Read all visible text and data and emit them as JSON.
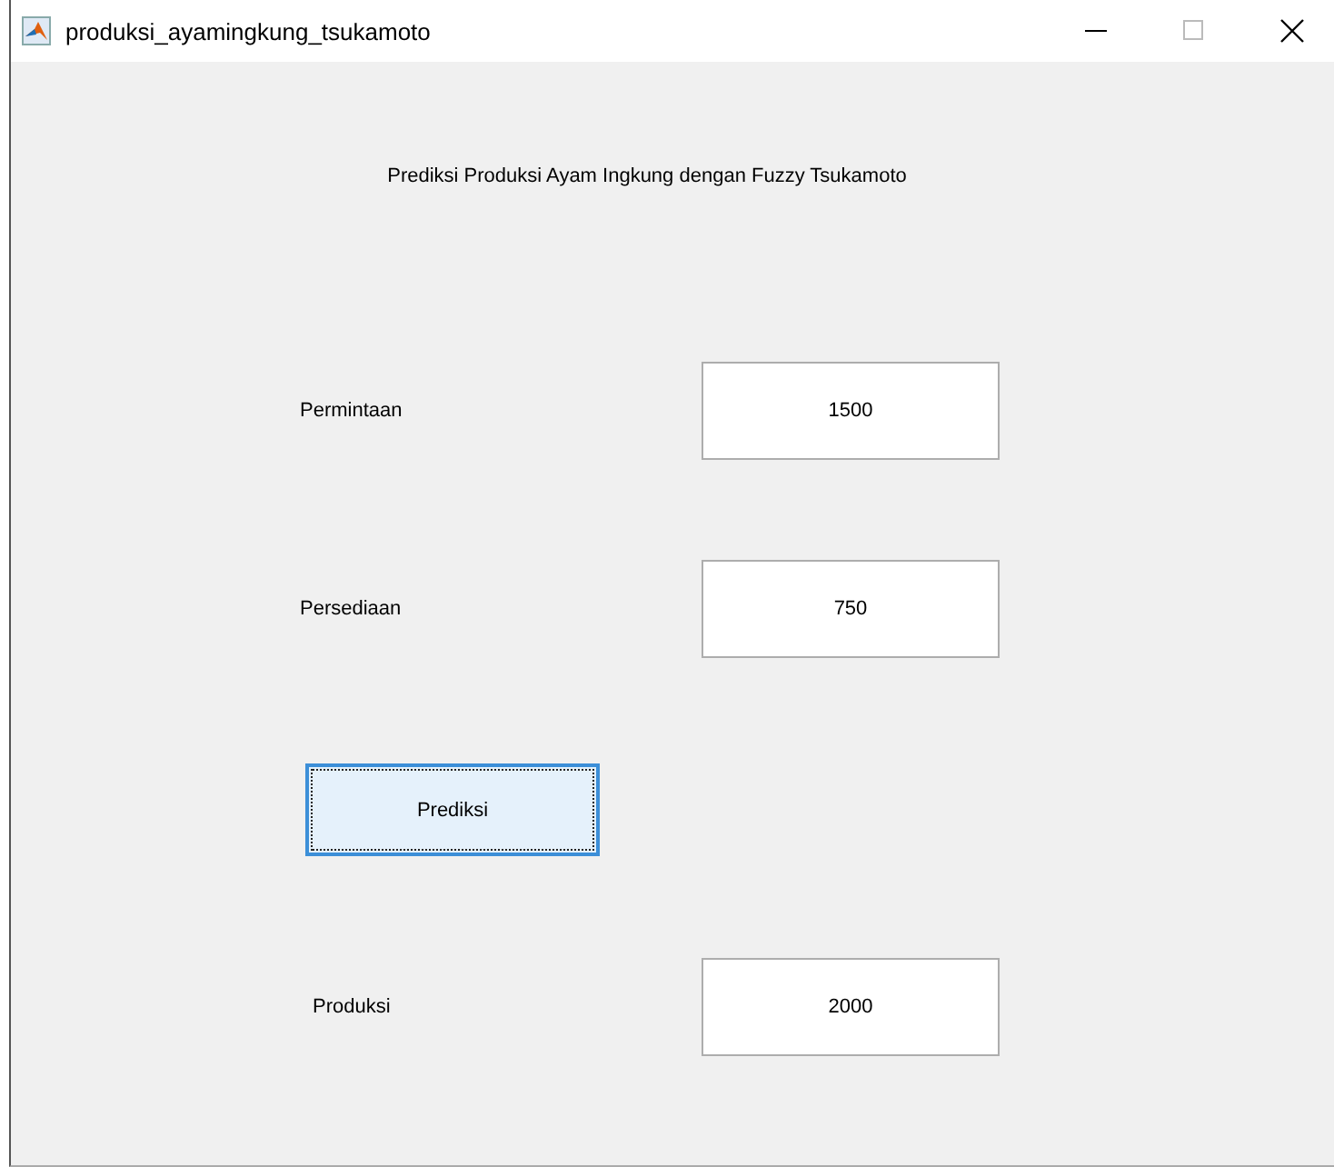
{
  "window": {
    "title": "produksi_ayamingkung_tsukamoto"
  },
  "heading": "Prediksi Produksi Ayam Ingkung dengan Fuzzy Tsukamoto",
  "rows": [
    {
      "kind": "field",
      "label": "Permintaan",
      "value": "1500"
    },
    {
      "kind": "field",
      "label": "Persediaan",
      "value": "750"
    },
    {
      "kind": "button",
      "label": "Prediksi"
    },
    {
      "kind": "field",
      "label": "Produksi",
      "value": "2000"
    }
  ]
}
